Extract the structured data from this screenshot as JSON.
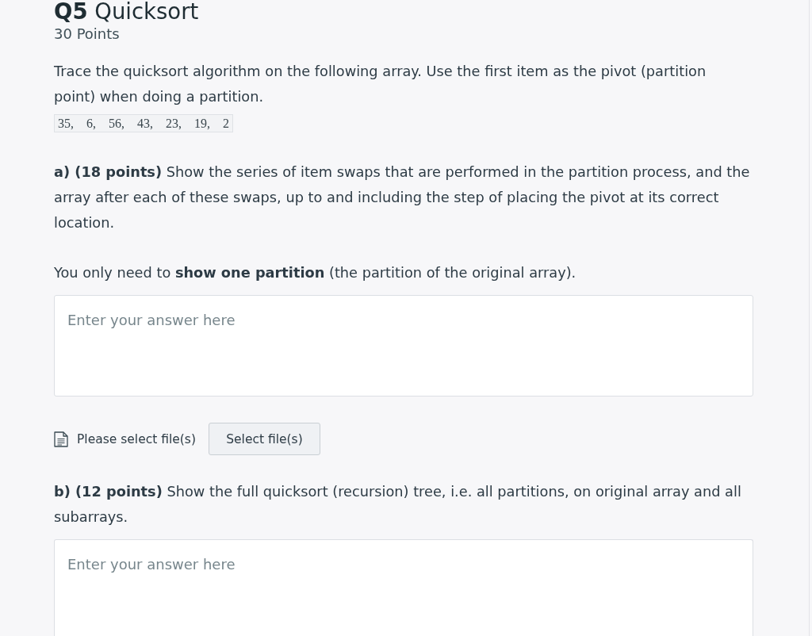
{
  "question": {
    "title": "**Q5** Quicksort",
    "points": "30 Points",
    "prompt": "Trace the quicksort algorithm on the following array. Use the first item as the pivot (partition point) when doing a partition.",
    "array": "35, 6, 56, 43, 23, 19, 2"
  },
  "parts": [
    {
      "text": "**a) (18 points)** Show the series of item swaps that are performed in the partition process, and the array after each of these swaps, up to and including the step of placing the pivot at its correct location.",
      "note": "You only need to **show one partition** (the partition of the original array).",
      "answer": {
        "placeholder": "Enter your answer here"
      },
      "upload": {
        "label": "Please select file(s)",
        "button": "Select file(s)"
      }
    },
    {
      "text": "**b) (12 points)** Show the full quicksort (recursion) tree, i.e. all partitions, on original array and all subarrays.",
      "answer": {
        "placeholder": "Enter your answer here"
      }
    }
  ]
}
